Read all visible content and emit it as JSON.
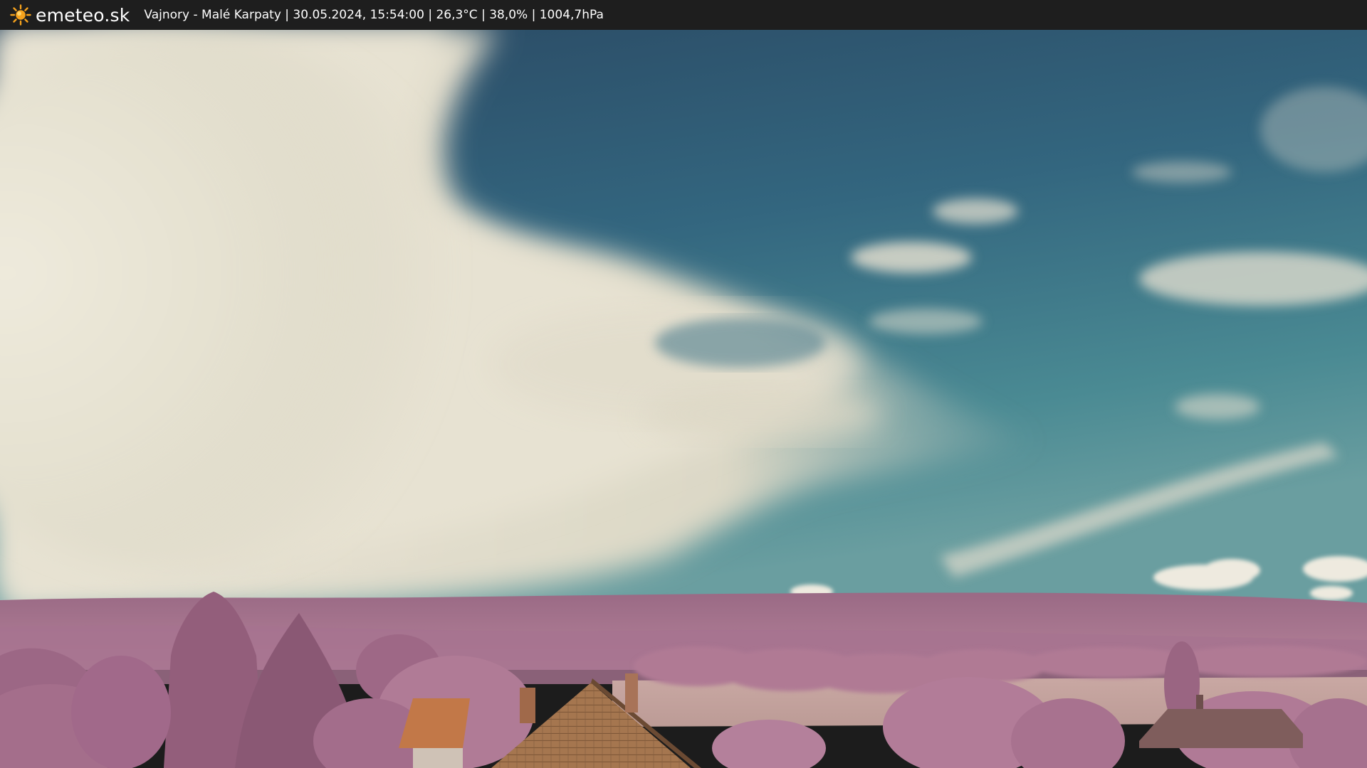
{
  "header": {
    "logo_icon": "sun-icon",
    "brand": "emeteo.sk",
    "caption": "Vajnory - Malé Karpaty | 30.05.2024, 15:54:00 | 26,3°C | 38,0% | 1004,7hPa"
  },
  "colors": {
    "bar": "#1e1e1e",
    "sun": "#f6a21c",
    "sky_top": "#2f5170",
    "sky_mid": "#3f7f8e",
    "cloud": "#ebe6d8",
    "foliage": "#a8708e",
    "field": "#c4a29e",
    "roof": "#a5764f"
  }
}
